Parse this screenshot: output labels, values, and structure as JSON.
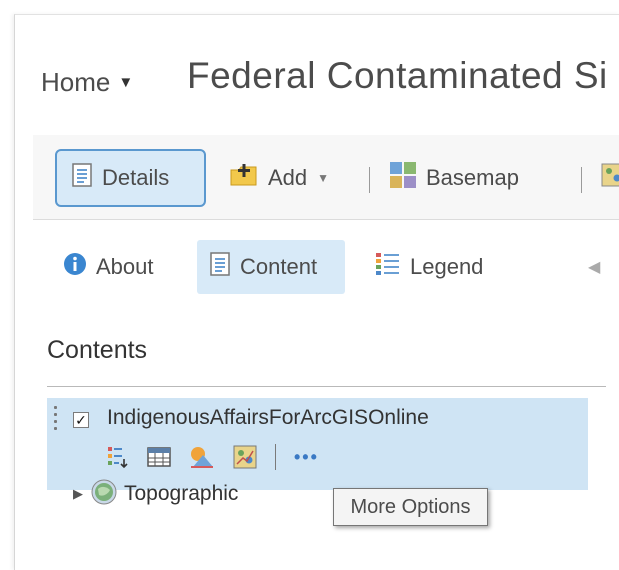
{
  "header": {
    "home_label": "Home",
    "home_caret": "▼",
    "title": "Federal Contaminated Si"
  },
  "toolbar": {
    "details_label": "Details",
    "add_label": "Add",
    "add_caret": "▼",
    "basemap_label": "Basemap"
  },
  "panel_tabs": {
    "about_label": "About",
    "content_label": "Content",
    "legend_label": "Legend",
    "collapse_glyph": "◀"
  },
  "contents": {
    "heading": "Contents",
    "layers": [
      {
        "name": "IndigenousAffairsForArcGISOnline",
        "checked": true,
        "more_glyph": "•••"
      }
    ],
    "basemap": {
      "name": "Topographic",
      "expand_glyph": "▶"
    }
  },
  "tooltip": {
    "text": "More Options"
  },
  "colors": {
    "accent": "#5a98cf",
    "active_bg": "#d8eaf8",
    "selected_row_bg": "#cfe4f4",
    "toolbar_bg": "#f7f7f7",
    "info_blue": "#3a86d0"
  },
  "icons": {
    "home_menu": "chevron-down-icon",
    "details": "details-document-icon",
    "add": "add-folder-icon",
    "basemap": "basemap-grid-icon",
    "about": "info-icon",
    "content": "content-document-icon",
    "legend": "legend-list-icon",
    "collapse": "collapse-left-icon",
    "layer_tools": [
      "show-legend-icon",
      "show-table-icon",
      "change-style-icon",
      "perform-analysis-icon",
      "more-options-icon"
    ],
    "basemap_layer": "globe-icon"
  }
}
